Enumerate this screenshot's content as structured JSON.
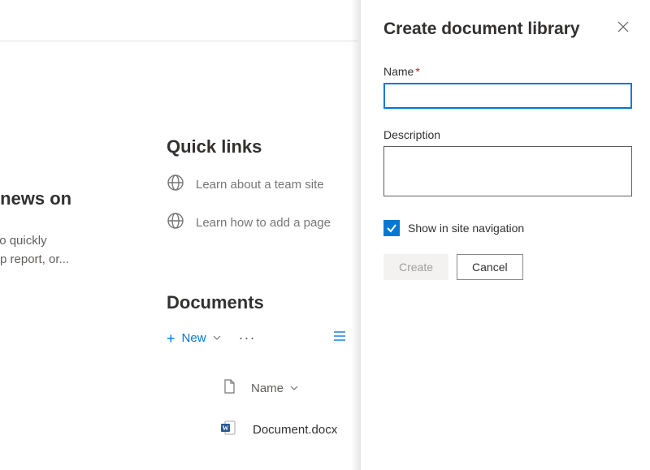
{
  "news": {
    "title_fragment": "with news on",
    "body_line1": "e able to quickly",
    "body_line2": "date, trip report, or..."
  },
  "quicklinks": {
    "title": "Quick links",
    "items": [
      {
        "label": "Learn about a team site"
      },
      {
        "label": "Learn how to add a page"
      }
    ]
  },
  "documents": {
    "title": "Documents",
    "new_label": "New",
    "col_name": "Name",
    "rows": [
      {
        "filename": "Document.docx"
      }
    ]
  },
  "panel": {
    "title": "Create document library",
    "name_label": "Name",
    "name_value": "",
    "desc_label": "Description",
    "desc_value": "",
    "show_nav_label": "Show in site navigation",
    "show_nav_checked": true,
    "create_label": "Create",
    "cancel_label": "Cancel"
  }
}
